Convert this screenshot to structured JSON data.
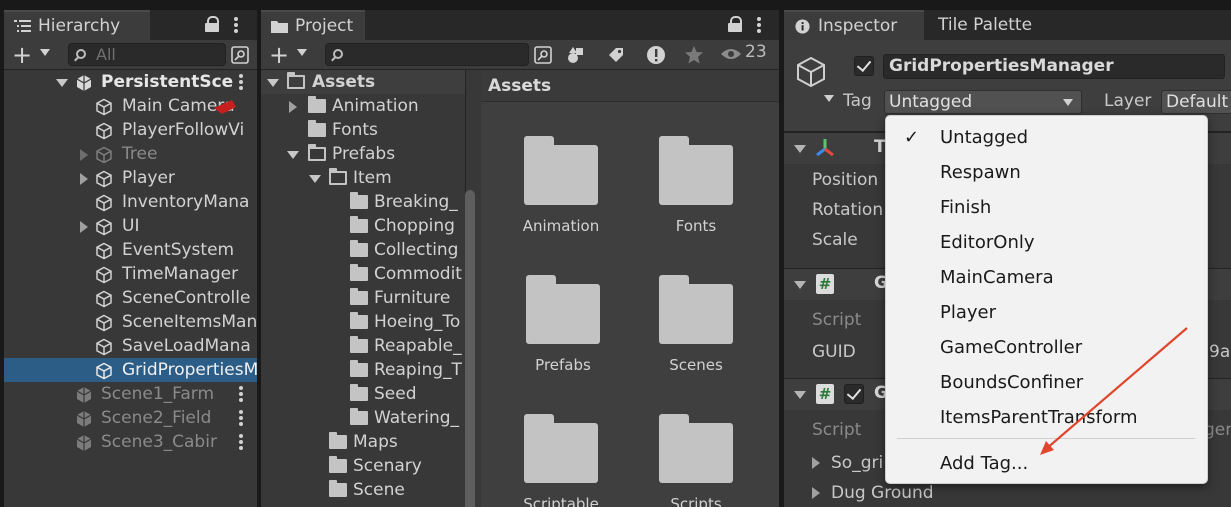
{
  "hierarchy": {
    "tab_label": "Hierarchy",
    "search_placeholder": "All",
    "items": [
      {
        "label": "PersistentSce"
      },
      {
        "label": "Main Camera"
      },
      {
        "label": "PlayerFollowVi"
      },
      {
        "label": "Tree"
      },
      {
        "label": "Player"
      },
      {
        "label": "InventoryMana"
      },
      {
        "label": "UI"
      },
      {
        "label": "EventSystem"
      },
      {
        "label": "TimeManager"
      },
      {
        "label": "SceneControlle"
      },
      {
        "label": "SceneItemsMan"
      },
      {
        "label": "SaveLoadMana"
      },
      {
        "label": "GridPropertiesM"
      },
      {
        "label": "Scene1_Farm"
      },
      {
        "label": "Scene2_Field"
      },
      {
        "label": "Scene3_Cabir"
      }
    ]
  },
  "project": {
    "tab_label": "Project",
    "search_value": "",
    "visible_count": "23",
    "tree": [
      {
        "label": "Assets"
      },
      {
        "label": "Animation"
      },
      {
        "label": "Fonts"
      },
      {
        "label": "Prefabs"
      },
      {
        "label": "Item"
      },
      {
        "label": "Breaking_"
      },
      {
        "label": "Chopping"
      },
      {
        "label": "Collecting"
      },
      {
        "label": "Commodit"
      },
      {
        "label": "Furniture"
      },
      {
        "label": "Hoeing_To"
      },
      {
        "label": "Reapable_"
      },
      {
        "label": "Reaping_T"
      },
      {
        "label": "Seed"
      },
      {
        "label": "Watering_"
      },
      {
        "label": "Maps"
      },
      {
        "label": "Scenary"
      },
      {
        "label": "Scene"
      }
    ],
    "grid_title": "Assets",
    "grid_items": [
      {
        "label": "Animation"
      },
      {
        "label": "Fonts"
      },
      {
        "label": "Prefabs"
      },
      {
        "label": "Scenes"
      },
      {
        "label": "Scriptable"
      },
      {
        "label": "Scripts"
      }
    ]
  },
  "inspector": {
    "tab_label": "Inspector",
    "tab2_label": "Tile Palette",
    "object_name": "GridPropertiesManager",
    "tag_label": "Tag",
    "tag_value": "Untagged",
    "layer_label": "Layer",
    "layer_value": "Default",
    "transform": {
      "title": "T",
      "position_label": "Position",
      "rotation_label": "Rotation",
      "scale_label": "Scale"
    },
    "comp1": {
      "title": "G",
      "script_label": "Script",
      "guid_label": "GUID",
      "guid_value_fragment": "9a"
    },
    "comp2": {
      "title": "G",
      "script_label": "Script",
      "script_value_fragment": "ger",
      "so_label": "So_gri",
      "dug_label": "Dug Ground"
    }
  },
  "tag_menu": {
    "items": [
      {
        "label": "Untagged",
        "checked": true
      },
      {
        "label": "Respawn"
      },
      {
        "label": "Finish"
      },
      {
        "label": "EditorOnly"
      },
      {
        "label": "MainCamera"
      },
      {
        "label": "Player"
      },
      {
        "label": "GameController"
      },
      {
        "label": "BoundsConfiner"
      },
      {
        "label": "ItemsParentTransform"
      }
    ],
    "add_label": "Add Tag..."
  },
  "colors": {
    "selection": "#2c5d87",
    "annotation_arrow": "#e0462d",
    "menu_bg": "#f2f2f2"
  }
}
